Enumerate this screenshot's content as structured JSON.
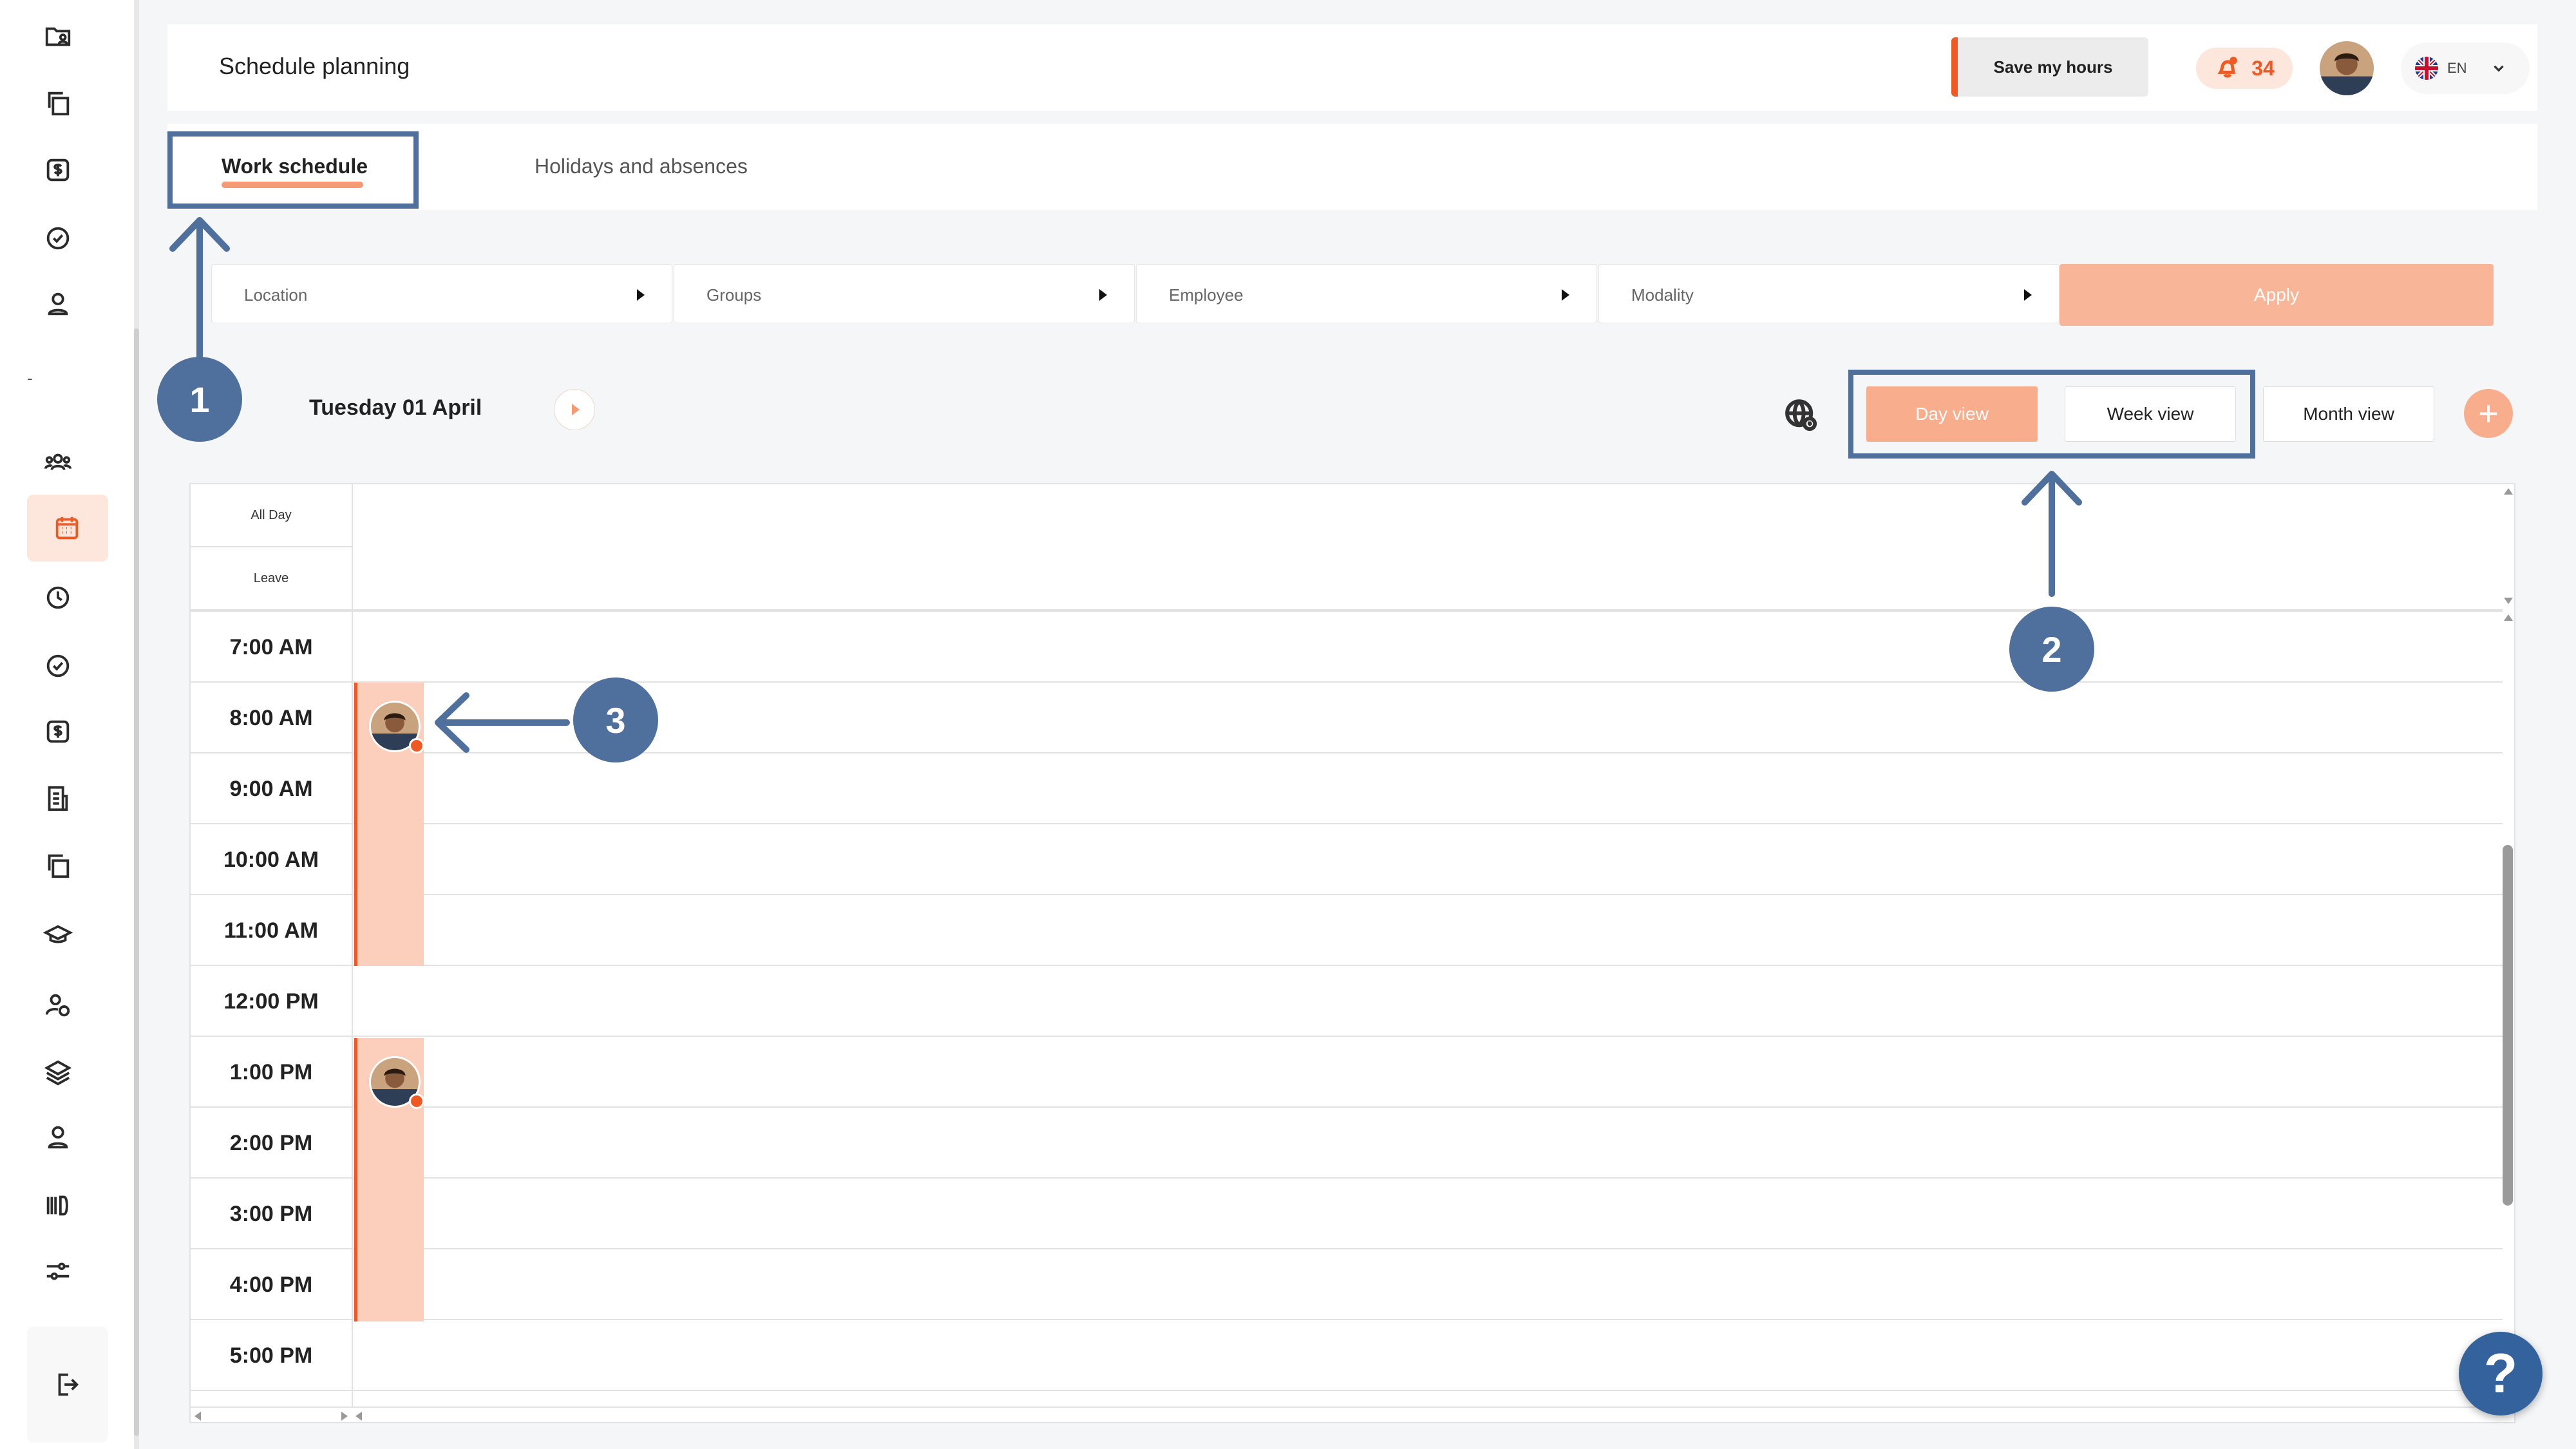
{
  "header": {
    "title": "Schedule planning",
    "save_label": "Save my hours",
    "notification_count": "34",
    "language": "EN"
  },
  "tabs": [
    {
      "label": "Work schedule",
      "active": true
    },
    {
      "label": "Holidays and absences",
      "active": false
    }
  ],
  "filters": {
    "location": "Location",
    "groups": "Groups",
    "employee": "Employee",
    "modality": "Modality",
    "apply": "Apply"
  },
  "calendar": {
    "date_label": "Tuesday 01 April",
    "views": [
      {
        "label": "Day view",
        "active": true
      },
      {
        "label": "Week view",
        "active": false
      },
      {
        "label": "Month view",
        "active": false
      }
    ],
    "all_day_label": "All Day",
    "leave_label": "Leave",
    "hours": [
      "7:00 AM",
      "8:00 AM",
      "9:00 AM",
      "10:00 AM",
      "11:00 AM",
      "12:00 PM",
      "1:00 PM",
      "2:00 PM",
      "3:00 PM",
      "4:00 PM",
      "5:00 PM"
    ],
    "events": [
      {
        "start": "8:00 AM",
        "end": "12:00 PM"
      },
      {
        "start": "1:00 PM",
        "end": "5:00 PM"
      }
    ]
  },
  "annotations": [
    "1",
    "2",
    "3"
  ],
  "help_label": "?",
  "colors": {
    "accent": "#ef5a24",
    "accent_light": "#f8ad8d",
    "annotation": "#4f6f9c"
  },
  "icons": {
    "sidebar": [
      "folder-user-icon",
      "copy-icon",
      "dollar-icon",
      "check-circle-icon",
      "user-icon",
      "users-icon",
      "calendar-icon",
      "clock-icon",
      "check-circle-icon",
      "dollar-icon",
      "document-icon",
      "copy-icon",
      "graduation-icon",
      "user-settings-icon",
      "layers-icon",
      "user-icon",
      "barcode-icon",
      "sliders-icon",
      "logout-icon"
    ]
  }
}
